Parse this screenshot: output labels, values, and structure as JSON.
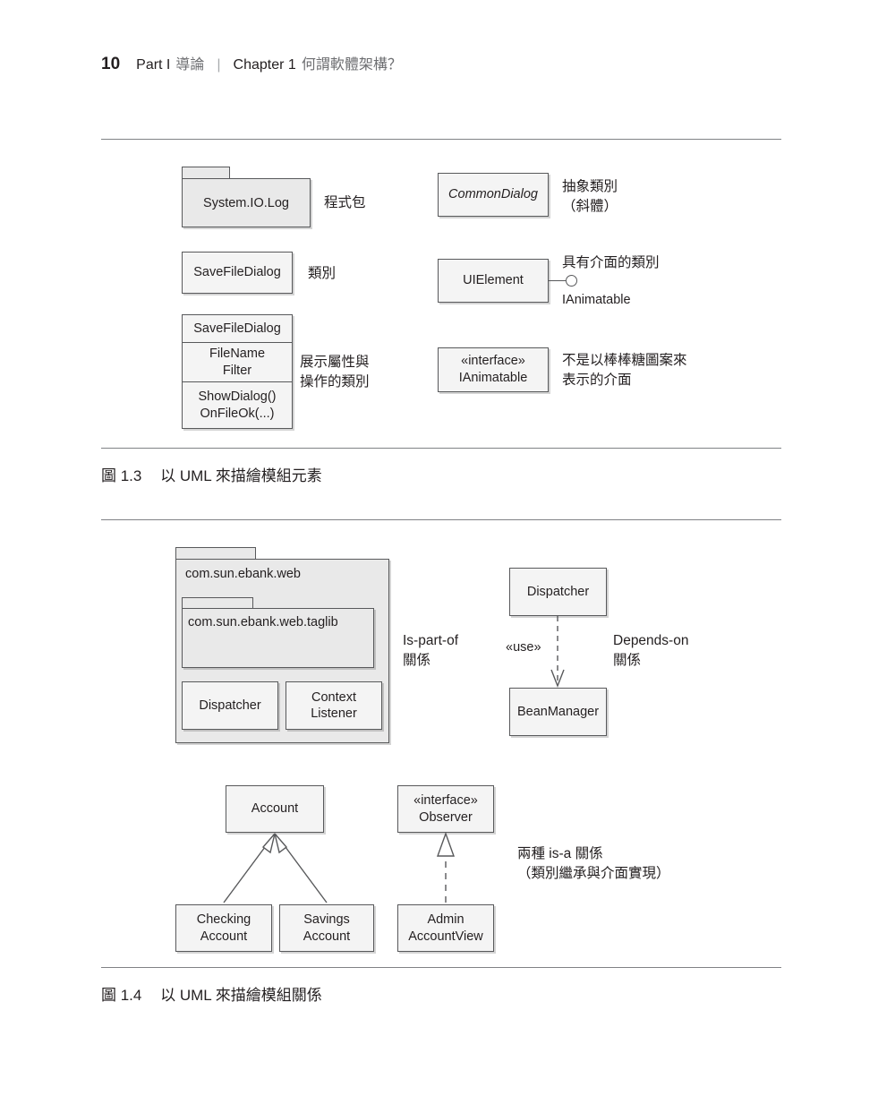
{
  "page": {
    "folio": "10",
    "part_label": "Part I",
    "part_title": "導論",
    "separator": "|",
    "chapter_label": "Chapter 1",
    "chapter_title": "何謂軟體架構？"
  },
  "figure_1_3": {
    "caption_number": "圖 1.3",
    "caption_text": "以 UML 來描繪模組元素",
    "nodes": {
      "package_log": "System.IO.Log",
      "class_savefiledialog": "SaveFileDialog",
      "class_detailed_name": "SaveFileDialog",
      "class_detailed_attributes": "FileName\nFilter",
      "class_detailed_operations": "ShowDialog()\nOnFileOk(...)",
      "class_commondialog": "CommonDialog",
      "class_uielement": "UIElement",
      "lollipop_label": "IAnimatable",
      "interface_stereotype": "«interface»",
      "interface_name": "IAnimatable"
    },
    "annotations": {
      "package": "程式包",
      "class": "類別",
      "class_detailed": "展示屬性與\n操作的類別",
      "abstract_class": "抽象類別\n（斜體）",
      "class_with_interface": "具有介面的類別",
      "interface_box": "不是以棒棒糖圖案來\n表示的介面"
    }
  },
  "figure_1_4": {
    "caption_number": "圖 1.4",
    "caption_text": "以 UML 來描繪模組關係",
    "nodes": {
      "package_outer": "com.sun.ebank.web",
      "package_inner": "com.sun.ebank.web.taglib",
      "class_dispatcher_inner": "Dispatcher",
      "class_contextlistener": "Context\nListener",
      "class_dispatcher": "Dispatcher",
      "class_beanmanager": "BeanManager",
      "dependency_stereotype": "«use»",
      "class_account": "Account",
      "class_checking": "Checking\nAccount",
      "class_savings": "Savings\nAccount",
      "interface_observer_stereotype": "«interface»",
      "interface_observer_name": "Observer",
      "class_adminaccountview": "Admin\nAccountView"
    },
    "annotations": {
      "is_part_of": "Is-part-of\n關係",
      "depends_on": "Depends-on\n關係",
      "is_a": "兩種 is-a 關係\n（類別繼承與介面實現）"
    }
  },
  "colors": {
    "ink": "#231f20",
    "rule": "#808285",
    "shape_stroke": "#58595b",
    "package_fill": "#e9e9e9",
    "class_fill": "#f4f4f4",
    "muted_text": "#6d6e71"
  }
}
